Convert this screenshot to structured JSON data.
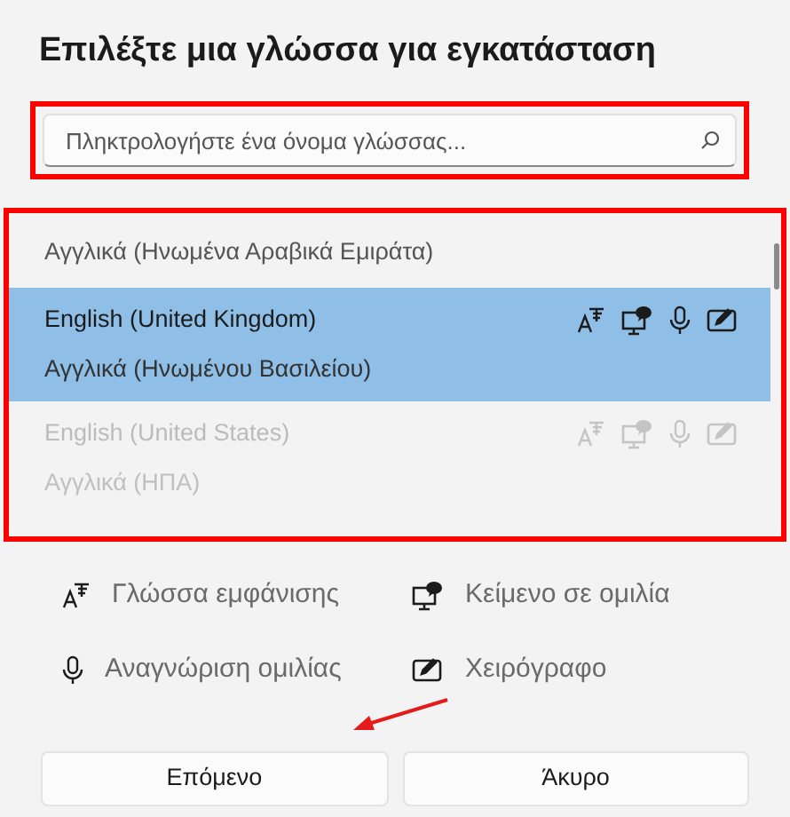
{
  "title": "Επιλέξτε μια γλώσσα για εγκατάσταση",
  "search": {
    "placeholder": "Πληκτρολογήστε ένα όνομα γλώσσας...",
    "highlighted": true
  },
  "language_list": {
    "highlighted": true,
    "items": [
      {
        "subtitle": "Αγγλικά (Ηνωμένα Αραβικά Εμιράτα)",
        "selected": false,
        "disabled": false
      },
      {
        "name": "English (United Kingdom)",
        "subtitle": "Αγγλικά (Ηνωμένου Βασιλείου)",
        "selected": true,
        "disabled": false
      },
      {
        "name": "English (United States)",
        "subtitle": "Αγγλικά (ΗΠΑ)",
        "selected": false,
        "disabled": true
      }
    ]
  },
  "legend": [
    {
      "kind": "display",
      "label": "Γλώσσα εμφάνισης"
    },
    {
      "kind": "tts",
      "label": "Κείμενο σε ομιλία"
    },
    {
      "kind": "speech",
      "label": "Αναγνώριση ομιλίας"
    },
    {
      "kind": "handwriting",
      "label": "Χειρόγραφο"
    }
  ],
  "buttons": [
    {
      "label": "Επόμενο",
      "arrow": true
    },
    {
      "label": "Άκυρο",
      "arrow": false
    }
  ]
}
